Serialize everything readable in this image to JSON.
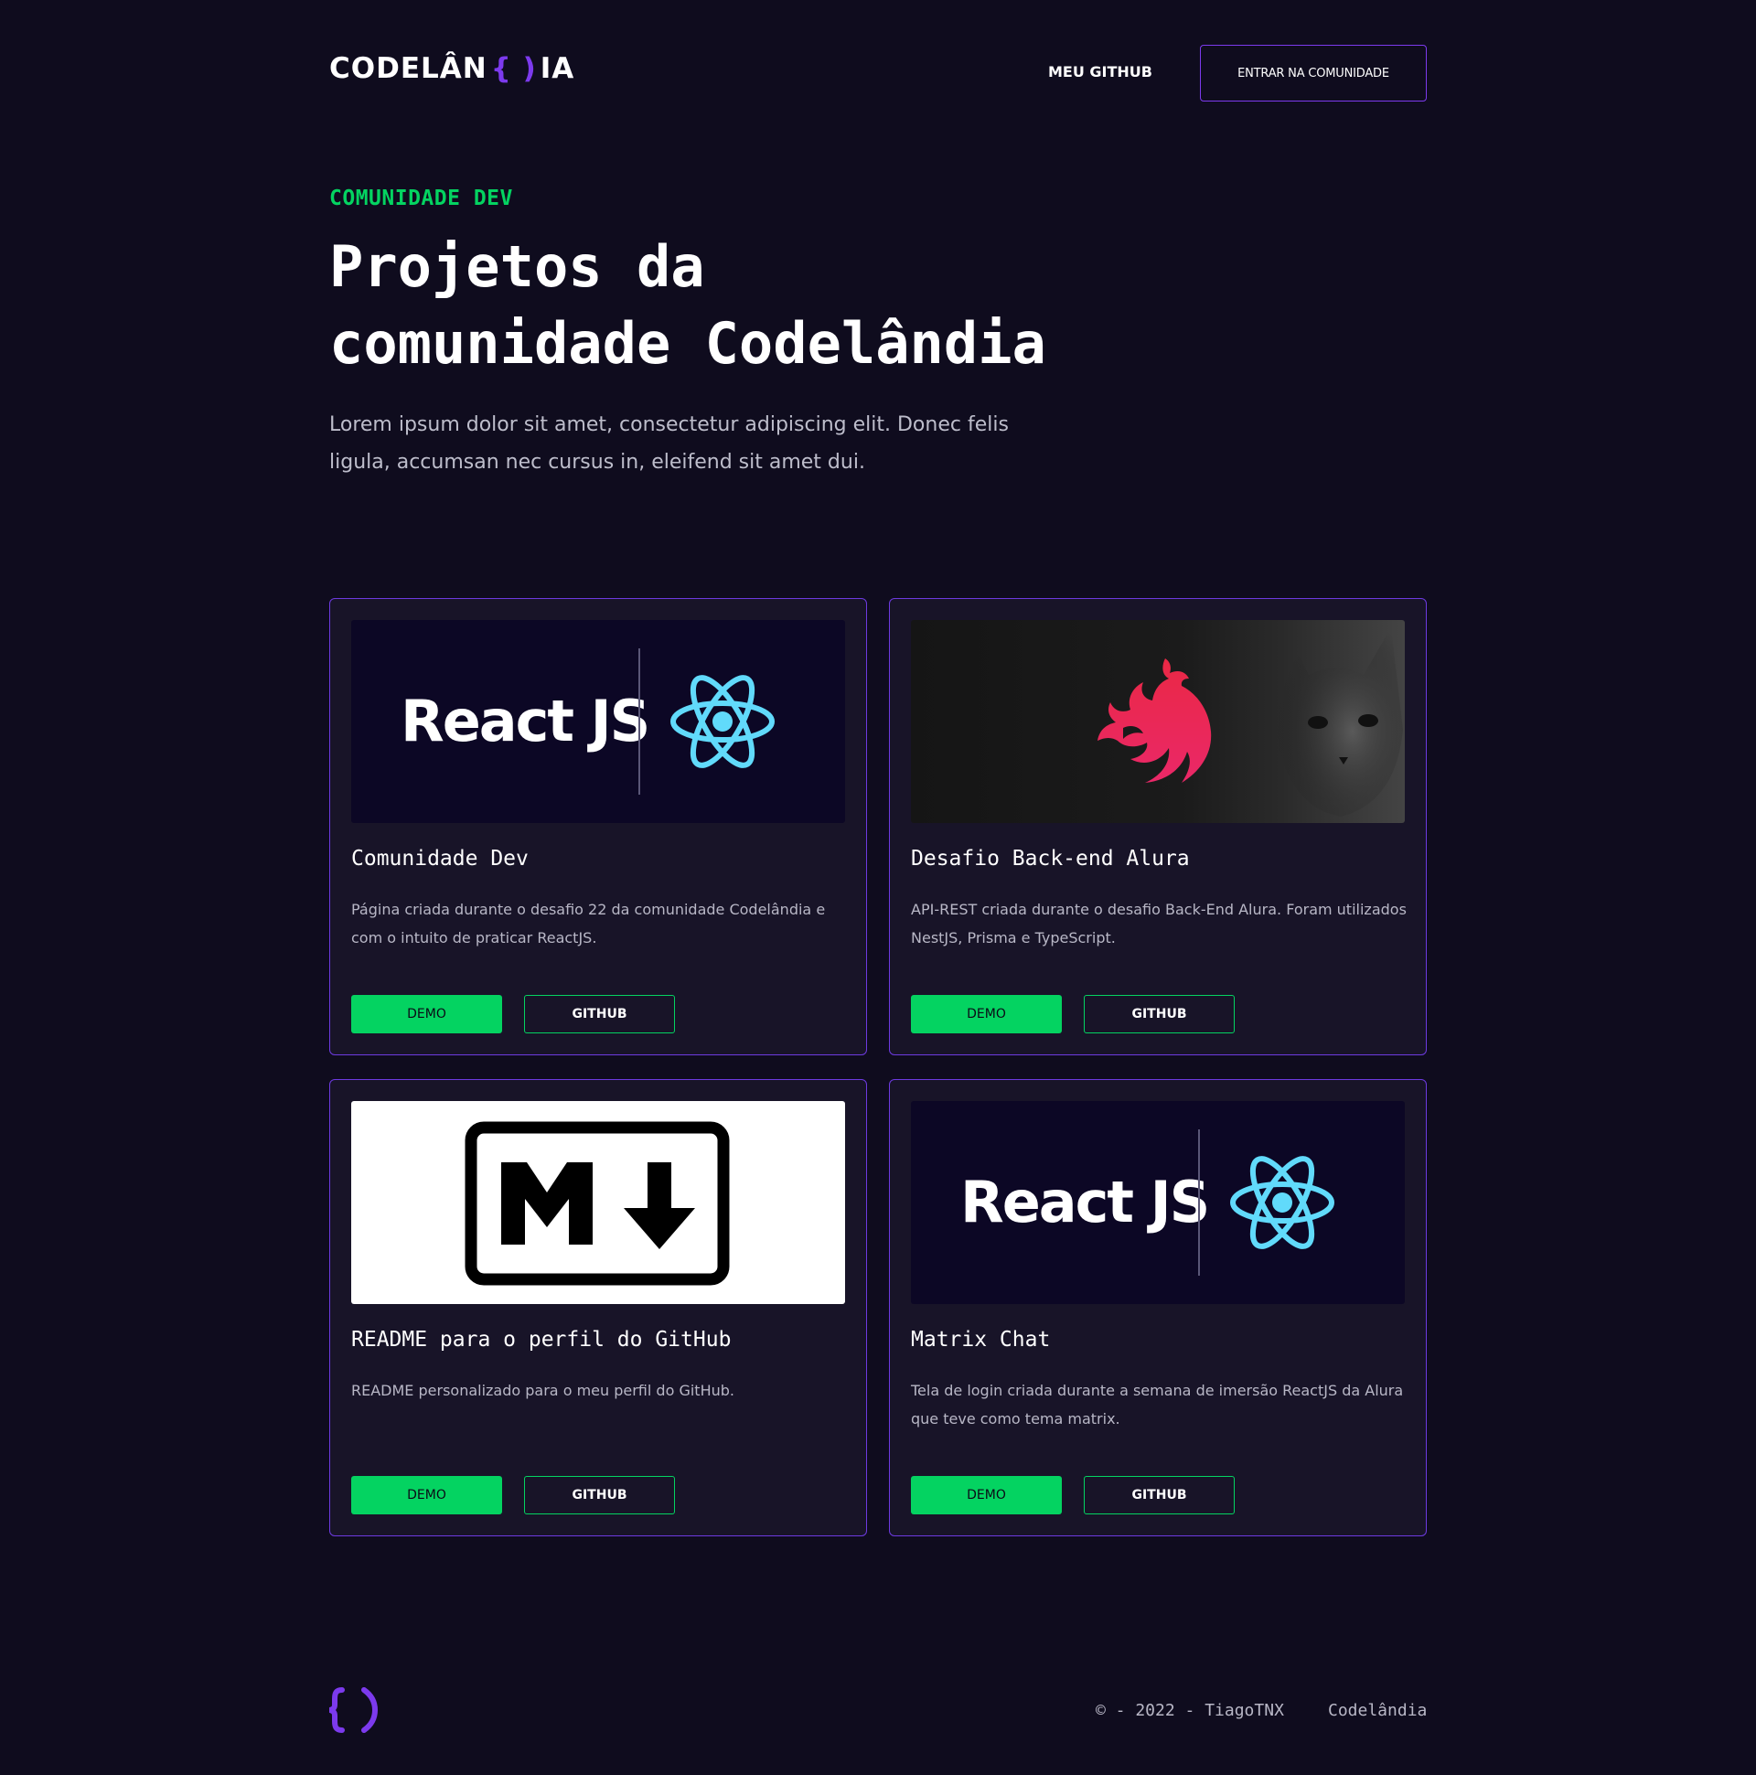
{
  "header": {
    "logo_text_left": "CODELÂN",
    "logo_braces": "{ )",
    "logo_text_right": "IA",
    "nav_github": "MEU GITHUB",
    "nav_community": "ENTRAR NA COMUNIDADE"
  },
  "hero": {
    "eyebrow": "COMUNIDADE DEV",
    "title_line1": "Projetos da",
    "title_line2": "comunidade Codelândia",
    "subtitle": "Lorem ipsum dolor sit amet, consectetur adipiscing elit. Donec felis ligula, accumsan nec cursus in, eleifend sit amet dui."
  },
  "projects": [
    {
      "title": "Comunidade Dev",
      "description": "Página criada durante o desafio 22 da comunidade Codelândia e com o intuito de praticar ReactJS.",
      "thumb": "react-logo",
      "thumb_text": "React JS",
      "demo_label": "DEMO",
      "github_label": "GITHUB"
    },
    {
      "title": "Desafio Back-end Alura",
      "description": "API-REST criada durante o desafio Back-End Alura. Foram utilizados NestJS, Prisma e TypeScript.",
      "thumb": "nestjs-logo",
      "demo_label": "DEMO",
      "github_label": "GITHUB"
    },
    {
      "title": "README para o perfil do GitHub",
      "description": "README personalizado para o meu perfil do GitHub.",
      "thumb": "markdown-logo",
      "demo_label": "DEMO",
      "github_label": "GITHUB"
    },
    {
      "title": "Matrix Chat",
      "description": "Tela de login criada durante a semana de imersão ReactJS da Alura que teve como tema matrix.",
      "thumb": "react-logo",
      "thumb_text": "React JS",
      "demo_label": "DEMO",
      "github_label": "GITHUB"
    }
  ],
  "footer": {
    "icon": "braces-icon",
    "copyright": "© - 2022 - TiagoTNX",
    "brand": "Codelândia"
  },
  "colors": {
    "background": "#0f0c1e",
    "card_background": "#181428",
    "accent_purple": "#7c3aed",
    "accent_green": "#04d361",
    "react_blue": "#61dafb",
    "nest_red": "#e0234e"
  }
}
